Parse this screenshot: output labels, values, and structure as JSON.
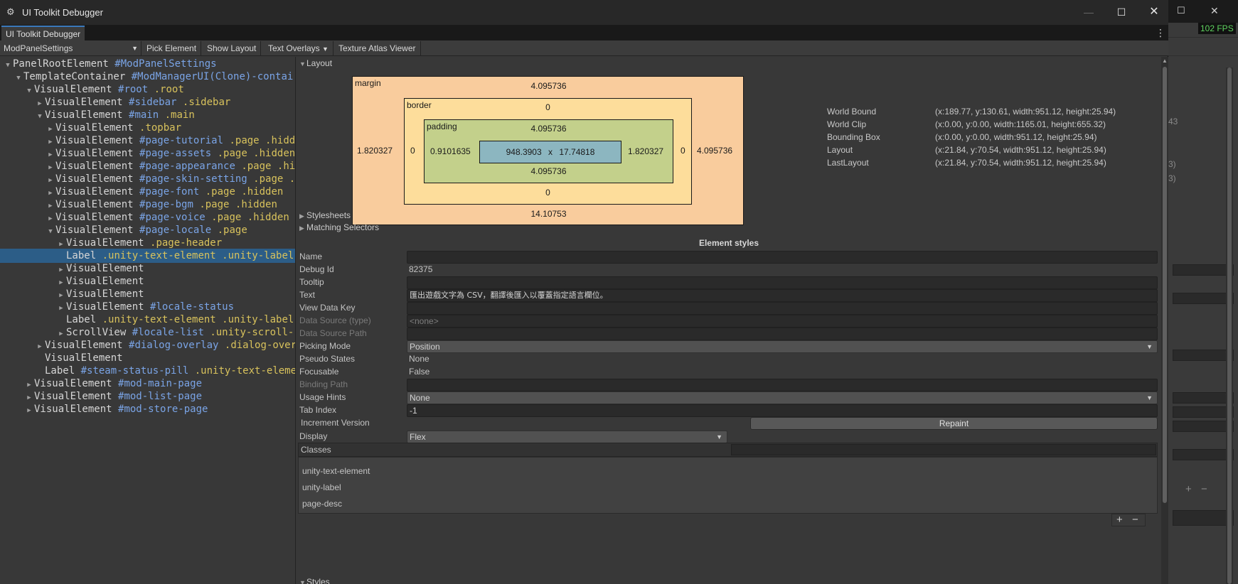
{
  "window": {
    "title": "UI Toolkit Debugger",
    "minimize_glyph": "—",
    "maximize_glyph": "☐",
    "close_glyph": "✕"
  },
  "background_window": {
    "fps": "102 FPS",
    "fragments": [
      "43",
      "3)",
      "3)",
      "+",
      "−"
    ]
  },
  "tab": {
    "label": "UI Toolkit Debugger",
    "menu_glyph": "⋮"
  },
  "toolbar": {
    "panel_select": "ModPanelSettings",
    "pick_element": "Pick Element",
    "show_layout": "Show Layout",
    "text_overlays": "Text Overlays",
    "texture_atlas_viewer": "Texture Atlas Viewer"
  },
  "tree": [
    {
      "type": "PanelRootElement",
      "id": "#ModPanelSettings",
      "classes": "",
      "arrow": "open"
    },
    {
      "type": "TemplateContainer",
      "id": "#ModManagerUI(Clone)-contai",
      "classes": "",
      "arrow": "open"
    },
    {
      "type": "VisualElement",
      "id": "#root",
      "classes": ".root",
      "arrow": "open"
    },
    {
      "type": "VisualElement",
      "id": "#sidebar",
      "classes": ".sidebar",
      "arrow": "closed"
    },
    {
      "type": "VisualElement",
      "id": "#main",
      "classes": ".main",
      "arrow": "open"
    },
    {
      "type": "VisualElement",
      "id": "",
      "classes": ".topbar",
      "arrow": "closed"
    },
    {
      "type": "VisualElement",
      "id": "#page-tutorial",
      "classes": ".page .hidd",
      "arrow": "closed"
    },
    {
      "type": "VisualElement",
      "id": "#page-assets",
      "classes": ".page .hidden",
      "arrow": "closed"
    },
    {
      "type": "VisualElement",
      "id": "#page-appearance",
      "classes": ".page .hi",
      "arrow": "closed"
    },
    {
      "type": "VisualElement",
      "id": "#page-skin-setting",
      "classes": ".page .",
      "arrow": "closed"
    },
    {
      "type": "VisualElement",
      "id": "#page-font",
      "classes": ".page .hidden",
      "arrow": "closed"
    },
    {
      "type": "VisualElement",
      "id": "#page-bgm",
      "classes": ".page .hidden",
      "arrow": "closed"
    },
    {
      "type": "VisualElement",
      "id": "#page-voice",
      "classes": ".page .hidden",
      "arrow": "closed"
    },
    {
      "type": "VisualElement",
      "id": "#page-locale",
      "classes": ".page",
      "arrow": "open"
    },
    {
      "type": "VisualElement",
      "id": "",
      "classes": ".page-header",
      "arrow": "closed"
    },
    {
      "type": "Label",
      "id": "",
      "classes": ".unity-text-element .unity-label",
      "arrow": "none"
    },
    {
      "type": "VisualElement",
      "id": "",
      "classes": "",
      "arrow": "closed"
    },
    {
      "type": "VisualElement",
      "id": "",
      "classes": "",
      "arrow": "closed"
    },
    {
      "type": "VisualElement",
      "id": "",
      "classes": "",
      "arrow": "closed"
    },
    {
      "type": "VisualElement",
      "id": "#locale-status",
      "classes": "",
      "arrow": "closed"
    },
    {
      "type": "Label",
      "id": "",
      "classes": ".unity-text-element .unity-label",
      "arrow": "none"
    },
    {
      "type": "ScrollView",
      "id": "#locale-list",
      "classes": ".unity-scroll-",
      "arrow": "closed"
    },
    {
      "type": "VisualElement",
      "id": "#dialog-overlay",
      "classes": ".dialog-over",
      "arrow": "closed"
    },
    {
      "type": "VisualElement",
      "id": "",
      "classes": "",
      "arrow": "none"
    },
    {
      "type": "Label",
      "id": "#steam-status-pill",
      "classes": ".unity-text-eleme",
      "arrow": "none"
    },
    {
      "type": "VisualElement",
      "id": "#mod-main-page",
      "classes": "",
      "arrow": "closed"
    },
    {
      "type": "VisualElement",
      "id": "#mod-list-page",
      "classes": "",
      "arrow": "closed"
    },
    {
      "type": "VisualElement",
      "id": "#mod-store-page",
      "classes": "",
      "arrow": "closed"
    }
  ],
  "layout": {
    "header": "Layout",
    "margin": {
      "label": "margin",
      "top": "4.095736",
      "left": "1.820327",
      "right": "4.095736",
      "bottom": "14.10753"
    },
    "border": {
      "label": "border",
      "top": "0",
      "left": "0",
      "right": "0",
      "bottom": "0"
    },
    "padding": {
      "label": "padding",
      "top": "4.095736",
      "left": "0.9101635",
      "right": "1.820327",
      "bottom": "4.095736"
    },
    "content": {
      "width": "948.3903",
      "x": "x",
      "height": "17.74818"
    },
    "bounds": [
      {
        "label": "World Bound",
        "value": "(x:189.77, y:130.61, width:951.12, height:25.94)"
      },
      {
        "label": "World Clip",
        "value": "(x:0.00, y:0.00, width:1165.01, height:655.32)"
      },
      {
        "label": "Bounding Box",
        "value": "(x:0.00, y:0.00, width:951.12, height:25.94)"
      },
      {
        "label": "Layout",
        "value": "(x:21.84, y:70.54, width:951.12, height:25.94)"
      },
      {
        "label": "LastLayout",
        "value": "(x:21.84, y:70.54, width:951.12, height:25.94)"
      }
    ]
  },
  "stylesheets_header": "Stylesheets",
  "matching_selectors_header": "Matching Selectors",
  "element_styles": {
    "header": "Element styles",
    "name": {
      "label": "Name",
      "value": ""
    },
    "debug_id": {
      "label": "Debug Id",
      "value": "82375"
    },
    "tooltip": {
      "label": "Tooltip",
      "value": ""
    },
    "text": {
      "label": "Text",
      "value": "匯出遊戲文字為 CSV，翻譯後匯入以覆蓋指定語言欄位。"
    },
    "view_data_key": {
      "label": "View Data Key",
      "value": ""
    },
    "data_source_type": {
      "label": "Data Source (type)",
      "value": "<none>"
    },
    "data_source_path": {
      "label": "Data Source Path",
      "value": ""
    },
    "picking_mode": {
      "label": "Picking Mode",
      "value": "Position"
    },
    "pseudo_states": {
      "label": "Pseudo States",
      "value": "None"
    },
    "focusable": {
      "label": "Focusable",
      "value": "False"
    },
    "binding_path": {
      "label": "Binding Path",
      "value": ""
    },
    "usage_hints": {
      "label": "Usage Hints",
      "value": "None"
    },
    "tab_index": {
      "label": "Tab Index",
      "value": "-1"
    },
    "increment_version": {
      "label": "Increment Version",
      "button": "Repaint"
    },
    "display": {
      "label": "Display",
      "value": "Flex"
    },
    "classes": {
      "label": "Classes",
      "items": [
        "unity-text-element",
        "unity-label",
        "page-desc"
      ],
      "add": "+",
      "remove": "−"
    }
  },
  "styles_header": "Styles",
  "colors": {
    "margin": "#f9cc9d",
    "border": "#fddd9b",
    "padding": "#c3d08b",
    "content": "#8cb6c0",
    "selection": "#2c5d87",
    "tree_id": "#7aa4e6",
    "tree_class": "#d8c25c"
  }
}
